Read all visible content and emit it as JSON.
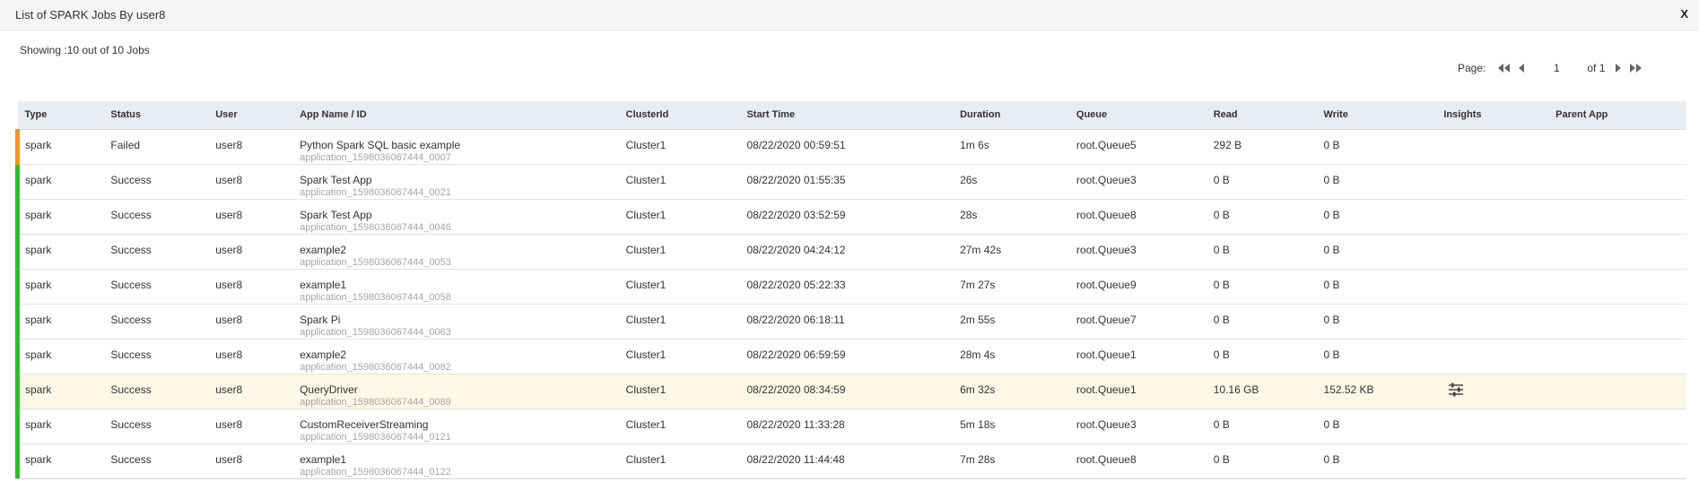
{
  "dialog": {
    "title": "List of SPARK Jobs By user8",
    "close_label": "X"
  },
  "summary": {
    "showing_text": "Showing :10 out of 10 Jobs"
  },
  "pagination": {
    "page_label": "Page:",
    "current_page": "1",
    "of_label": "of 1",
    "icons": [
      "first-page-icon",
      "previous-page-icon",
      "next-page-icon",
      "last-page-icon"
    ]
  },
  "table": {
    "columns": [
      "Type",
      "Status",
      "User",
      "App Name / ID",
      "ClusterId",
      "Start Time",
      "Duration",
      "Queue",
      "Read",
      "Write",
      "Insights",
      "Parent App"
    ],
    "rows": [
      {
        "type": "spark",
        "status": "Failed",
        "user": "user8",
        "app_name": "Python Spark SQL basic example",
        "app_id": "application_1598036067444_0007",
        "cluster": "Cluster1",
        "start_time": "08/22/2020 00:59:51",
        "duration": "1m 6s",
        "queue": "root.Queue5",
        "read": "292 B",
        "write": "0 B",
        "insights": "",
        "parent_app": ""
      },
      {
        "type": "spark",
        "status": "Success",
        "user": "user8",
        "app_name": "Spark Test App",
        "app_id": "application_1598036067444_0021",
        "cluster": "Cluster1",
        "start_time": "08/22/2020 01:55:35",
        "duration": "26s",
        "queue": "root.Queue3",
        "read": "0 B",
        "write": "0 B",
        "insights": "",
        "parent_app": ""
      },
      {
        "type": "spark",
        "status": "Success",
        "user": "user8",
        "app_name": "Spark Test App",
        "app_id": "application_1598036067444_0046",
        "cluster": "Cluster1",
        "start_time": "08/22/2020 03:52:59",
        "duration": "28s",
        "queue": "root.Queue8",
        "read": "0 B",
        "write": "0 B",
        "insights": "",
        "parent_app": ""
      },
      {
        "type": "spark",
        "status": "Success",
        "user": "user8",
        "app_name": "example2",
        "app_id": "application_1598036067444_0053",
        "cluster": "Cluster1",
        "start_time": "08/22/2020 04:24:12",
        "duration": "27m 42s",
        "queue": "root.Queue3",
        "read": "0 B",
        "write": "0 B",
        "insights": "",
        "parent_app": ""
      },
      {
        "type": "spark",
        "status": "Success",
        "user": "user8",
        "app_name": "example1",
        "app_id": "application_1598036067444_0058",
        "cluster": "Cluster1",
        "start_time": "08/22/2020 05:22:33",
        "duration": "7m 27s",
        "queue": "root.Queue9",
        "read": "0 B",
        "write": "0 B",
        "insights": "",
        "parent_app": ""
      },
      {
        "type": "spark",
        "status": "Success",
        "user": "user8",
        "app_name": "Spark Pi",
        "app_id": "application_1598036067444_0063",
        "cluster": "Cluster1",
        "start_time": "08/22/2020 06:18:11",
        "duration": "2m 55s",
        "queue": "root.Queue7",
        "read": "0 B",
        "write": "0 B",
        "insights": "",
        "parent_app": ""
      },
      {
        "type": "spark",
        "status": "Success",
        "user": "user8",
        "app_name": "example2",
        "app_id": "application_1598036067444_0082",
        "cluster": "Cluster1",
        "start_time": "08/22/2020 06:59:59",
        "duration": "28m 4s",
        "queue": "root.Queue1",
        "read": "0 B",
        "write": "0 B",
        "insights": "",
        "parent_app": ""
      },
      {
        "type": "spark",
        "status": "Success",
        "user": "user8",
        "app_name": "QueryDriver",
        "app_id": "application_1598036067444_0089",
        "cluster": "Cluster1",
        "start_time": "08/22/2020 08:34:59",
        "duration": "6m 32s",
        "queue": "root.Queue1",
        "read": "10.16 GB",
        "write": "152.52 KB",
        "insights": "sliders-icon",
        "parent_app": ""
      },
      {
        "type": "spark",
        "status": "Success",
        "user": "user8",
        "app_name": "CustomReceiverStreaming",
        "app_id": "application_1598036067444_0121",
        "cluster": "Cluster1",
        "start_time": "08/22/2020 11:33:28",
        "duration": "5m 18s",
        "queue": "root.Queue3",
        "read": "0 B",
        "write": "0 B",
        "insights": "",
        "parent_app": ""
      },
      {
        "type": "spark",
        "status": "Success",
        "user": "user8",
        "app_name": "example1",
        "app_id": "application_1598036067444_0122",
        "cluster": "Cluster1",
        "start_time": "08/22/2020 11:44:48",
        "duration": "7m 28s",
        "queue": "root.Queue8",
        "read": "0 B",
        "write": "0 B",
        "insights": "",
        "parent_app": ""
      }
    ]
  },
  "colors": {
    "success": "#2ebd2e",
    "failed": "#f0961f",
    "header_bg": "#e9ecf3",
    "highlight_row": "#fdf8e6",
    "app_id_text": "#a6a6a6"
  }
}
